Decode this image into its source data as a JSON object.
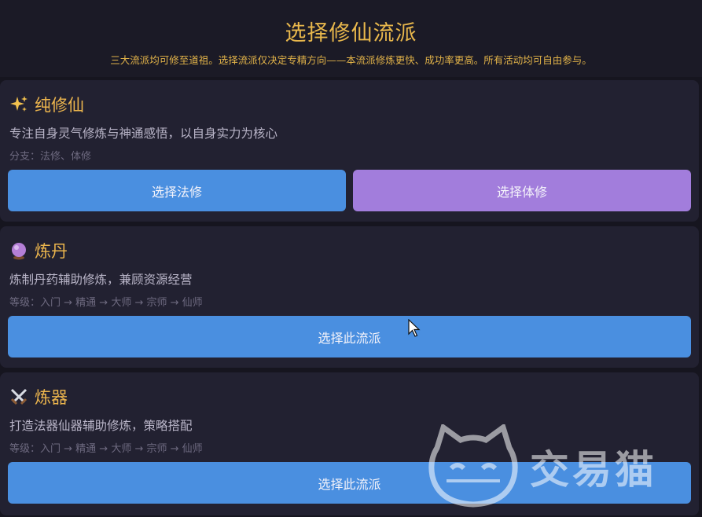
{
  "header": {
    "title": "选择修仙流派",
    "subtitle": "三大流派均可修至道祖。选择流派仅决定专精方向——本流派修炼更快、成功率更高。所有活动均可自由参与。"
  },
  "paths": [
    {
      "icon": "sparkles-icon",
      "name": "纯修仙",
      "description": "专注自身灵气修炼与神通感悟，以自身实力为核心",
      "meta": "分支：法修、体修",
      "buttons": [
        "选择法修",
        "选择体修"
      ]
    },
    {
      "icon": "crystal-ball-icon",
      "name": "炼丹",
      "description": "炼制丹药辅助修炼，兼顾资源经营",
      "meta": "等级：入门 → 精通 → 大师 → 宗师 → 仙师",
      "button": "选择此流派"
    },
    {
      "icon": "crossed-swords-icon",
      "name": "炼器",
      "description": "打造法器仙器辅助修炼，策略搭配",
      "meta": "等级：入门 → 精通 → 大师 → 宗师 → 仙师",
      "button": "选择此流派"
    }
  ],
  "watermark": {
    "text": "交易猫"
  },
  "colors": {
    "accent_gold": "#e9b84c",
    "button_blue": "#4a8fe0",
    "button_purple": "#a27ddc",
    "card_bg": "#222131",
    "page_bg": "#16151f"
  }
}
